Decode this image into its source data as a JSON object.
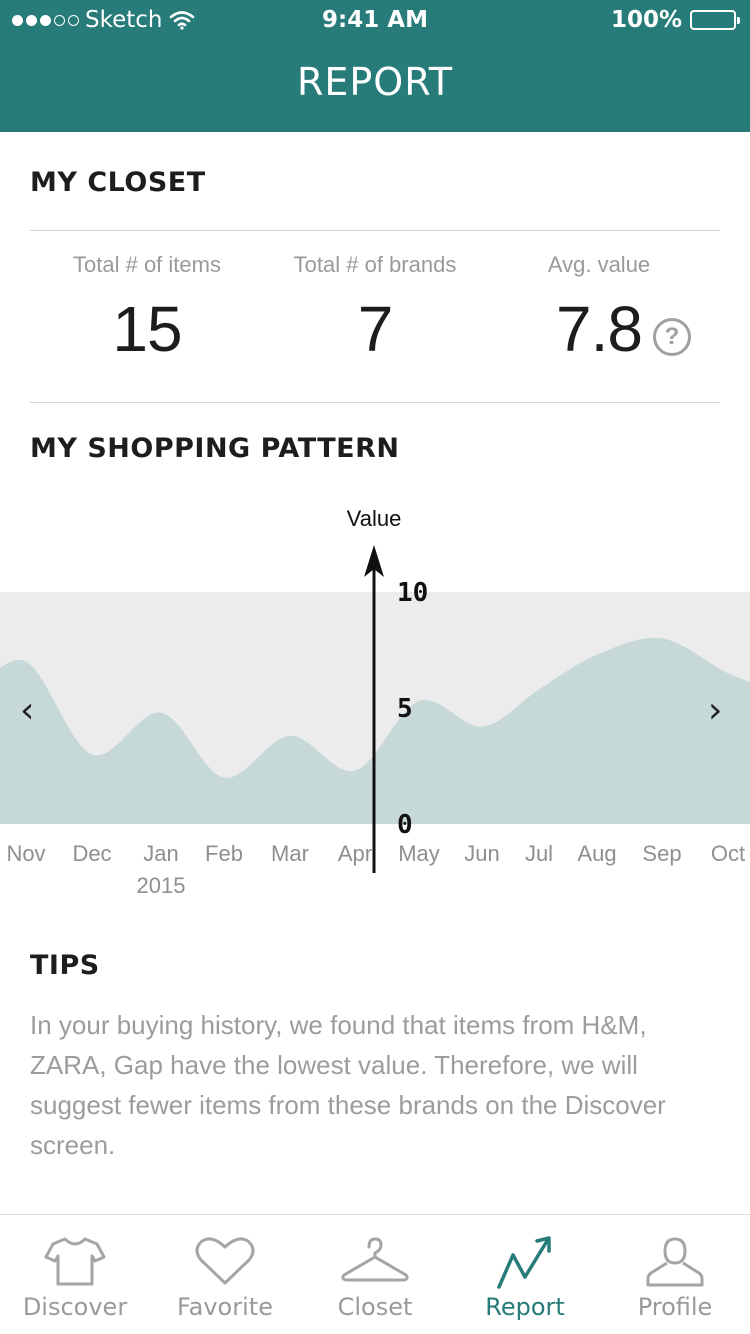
{
  "status": {
    "carrier": "Sketch",
    "time": "9:41 AM",
    "battery": "100%",
    "signal_bars": 5,
    "signal_filled": 3
  },
  "header": {
    "title": "REPORT"
  },
  "closet": {
    "title": "MY CLOSET",
    "stats": [
      {
        "label": "Total # of items",
        "value": "15"
      },
      {
        "label": "Total # of brands",
        "value": "7"
      },
      {
        "label": "Avg. value",
        "value": "7.8"
      }
    ],
    "help_icon": "question-circle-icon",
    "help_glyph": "?"
  },
  "pattern": {
    "title": "MY SHOPPING PATTERN"
  },
  "chart_data": {
    "type": "area",
    "ylabel": "Value",
    "ylim": [
      0,
      10
    ],
    "yticks": [
      "10",
      "5",
      "0"
    ],
    "x": [
      "Nov",
      "Dec",
      "Jan",
      "Feb",
      "Mar",
      "Apr",
      "May",
      "Jun",
      "Jul",
      "Aug",
      "Sep",
      "Oct"
    ],
    "x_sublabel": {
      "index": 2,
      "text": "2015"
    },
    "values": [
      7.0,
      3.0,
      4.8,
      2.0,
      3.8,
      2.3,
      5.3,
      4.2,
      5.8,
      7.3,
      8.0,
      6.5
    ],
    "fill_color": "#c6d9d8",
    "band_color": "#ececec",
    "prev_label": "‹",
    "next_label": "›"
  },
  "tips": {
    "title": "TIPS",
    "text": "In your buying history, we found that items from H&M, ZARA, Gap have the lowest value. Therefore, we will suggest fewer items from these brands on the Discover screen."
  },
  "tabs": [
    {
      "label": "Discover",
      "icon": "tshirt-icon",
      "active": false
    },
    {
      "label": "Favorite",
      "icon": "heart-icon",
      "active": false
    },
    {
      "label": "Closet",
      "icon": "hanger-icon",
      "active": false
    },
    {
      "label": "Report",
      "icon": "trend-arrow-icon",
      "active": true
    },
    {
      "label": "Profile",
      "icon": "person-icon",
      "active": false
    }
  ],
  "colors": {
    "accent": "#277b78",
    "muted_text": "#9a9a9a"
  }
}
